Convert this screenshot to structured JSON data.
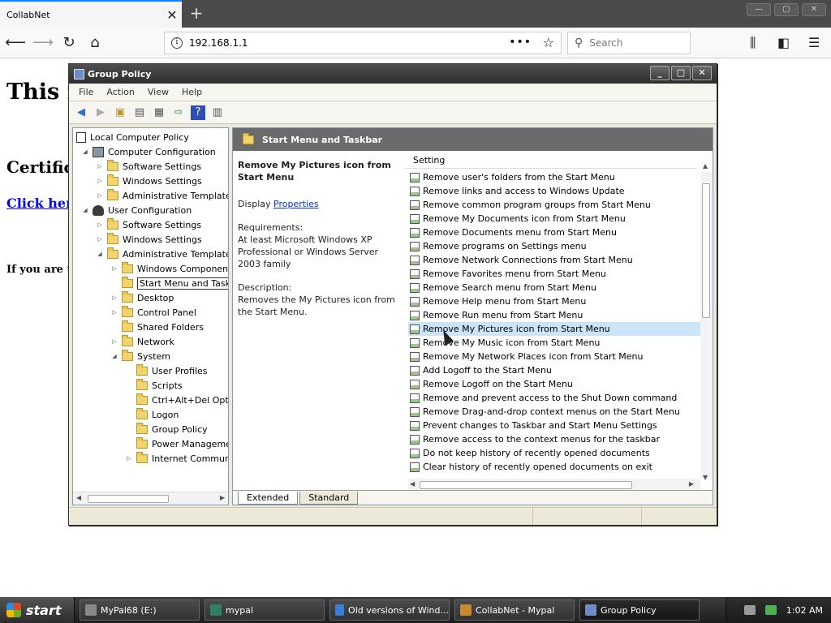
{
  "browser": {
    "tab_title": "CollabNet",
    "tab_close": "✕",
    "new_tab": "+",
    "url": "192.168.1.1",
    "search_placeholder": "Search"
  },
  "page": {
    "heading": "This i",
    "cert_heading": "Certific",
    "link_text": "Click her",
    "note_text": "If you are t"
  },
  "gp_window": {
    "title": "Group Policy",
    "menu": [
      "File",
      "Action",
      "View",
      "Help"
    ],
    "tree": [
      {
        "label": "Local Computer Policy"
      },
      {
        "label": "Computer Configuration"
      },
      {
        "label": "Software Settings"
      },
      {
        "label": "Windows Settings"
      },
      {
        "label": "Administrative Templates"
      },
      {
        "label": "User Configuration"
      },
      {
        "label": "Software Settings"
      },
      {
        "label": "Windows Settings"
      },
      {
        "label": "Administrative Templates"
      },
      {
        "label": "Windows Components"
      },
      {
        "label": "Start Menu and Taskbar"
      },
      {
        "label": "Desktop"
      },
      {
        "label": "Control Panel"
      },
      {
        "label": "Shared Folders"
      },
      {
        "label": "Network"
      },
      {
        "label": "System"
      },
      {
        "label": "User Profiles"
      },
      {
        "label": "Scripts"
      },
      {
        "label": "Ctrl+Alt+Del Opti"
      },
      {
        "label": "Logon"
      },
      {
        "label": "Group Policy"
      },
      {
        "label": "Power Managemer"
      },
      {
        "label": "Internet Communi"
      }
    ],
    "detail_header": "Start Menu and Taskbar",
    "extended": {
      "title": "Remove My Pictures icon from Start Menu",
      "display_prefix": "Display",
      "display_link": "Properties",
      "requirements_label": "Requirements:",
      "requirements": "At least Microsoft Windows XP Professional or Windows Server 2003 family",
      "description_label": "Description:",
      "description": "Removes the My Pictures icon from the Start Menu."
    },
    "list_header": "Setting",
    "settings": [
      "Remove user's folders from the Start Menu",
      "Remove links and access to Windows Update",
      "Remove common program groups from Start Menu",
      "Remove My Documents icon from Start Menu",
      "Remove Documents menu from Start Menu",
      "Remove programs on Settings menu",
      "Remove Network Connections from Start Menu",
      "Remove Favorites menu from Start Menu",
      "Remove Search menu from Start Menu",
      "Remove Help menu from Start Menu",
      "Remove Run menu from Start Menu",
      "Remove My Pictures icon from Start Menu",
      "Remove My Music icon from Start Menu",
      "Remove My Network Places icon from Start Menu",
      "Add Logoff to the Start Menu",
      "Remove Logoff on the Start Menu",
      "Remove and prevent access to the Shut Down command",
      "Remove Drag-and-drop context menus on the Start Menu",
      "Prevent changes to Taskbar and Start Menu Settings",
      "Remove access to the context menus for the taskbar",
      "Do not keep history of recently opened documents",
      "Clear history of recently opened documents on exit"
    ],
    "selected_setting": "Remove My Pictures icon from Start Menu",
    "tabs": [
      "Extended",
      "Standard"
    ]
  },
  "taskbar": {
    "start_label": "start",
    "tasks": [
      "MyPal68 (E:)",
      "mypal",
      "Old versions of Wind...",
      "CollabNet - Mypal",
      "Group Policy"
    ],
    "clock": "1:02 AM"
  }
}
